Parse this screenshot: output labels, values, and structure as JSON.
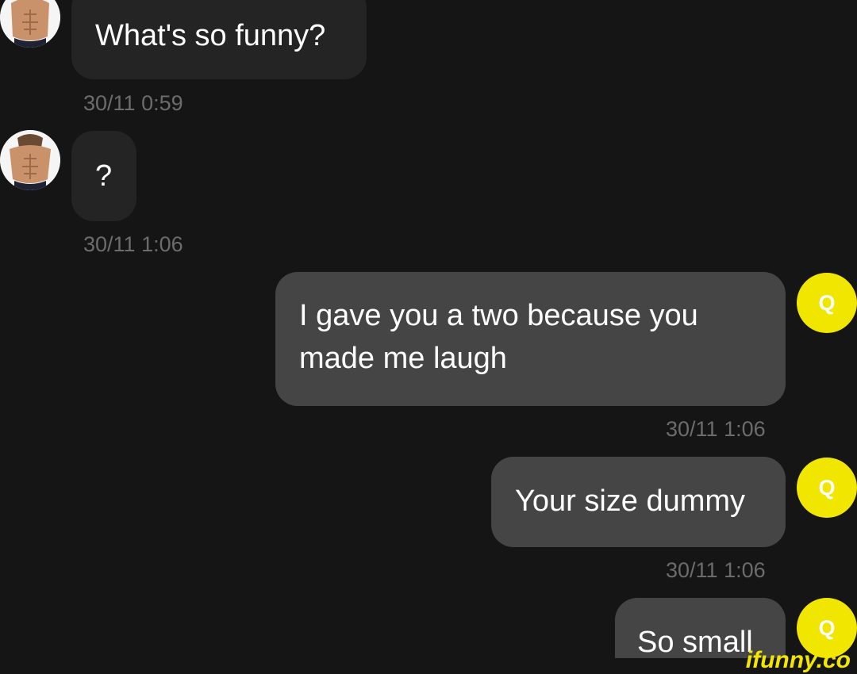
{
  "messages": [
    {
      "direction": "incoming",
      "text": "What's so funny?",
      "timestamp": "30/11 0:59"
    },
    {
      "direction": "incoming",
      "text": "?",
      "timestamp": "30/11 1:06"
    },
    {
      "direction": "outgoing",
      "text": "I gave you a two because you made me laugh",
      "timestamp": "30/11 1:06",
      "avatar_letter": "Q"
    },
    {
      "direction": "outgoing",
      "text": "Your size dummy",
      "timestamp": "30/11 1:06",
      "avatar_letter": "Q"
    },
    {
      "direction": "outgoing",
      "text": "So small",
      "avatar_letter": "Q"
    }
  ],
  "watermark": "ifunny.co",
  "colors": {
    "background": "#151515",
    "incoming_bubble": "#242424",
    "outgoing_bubble": "#454545",
    "outgoing_avatar": "#f1e600",
    "timestamp": "#6c6c6c",
    "watermark": "#f3e500"
  }
}
